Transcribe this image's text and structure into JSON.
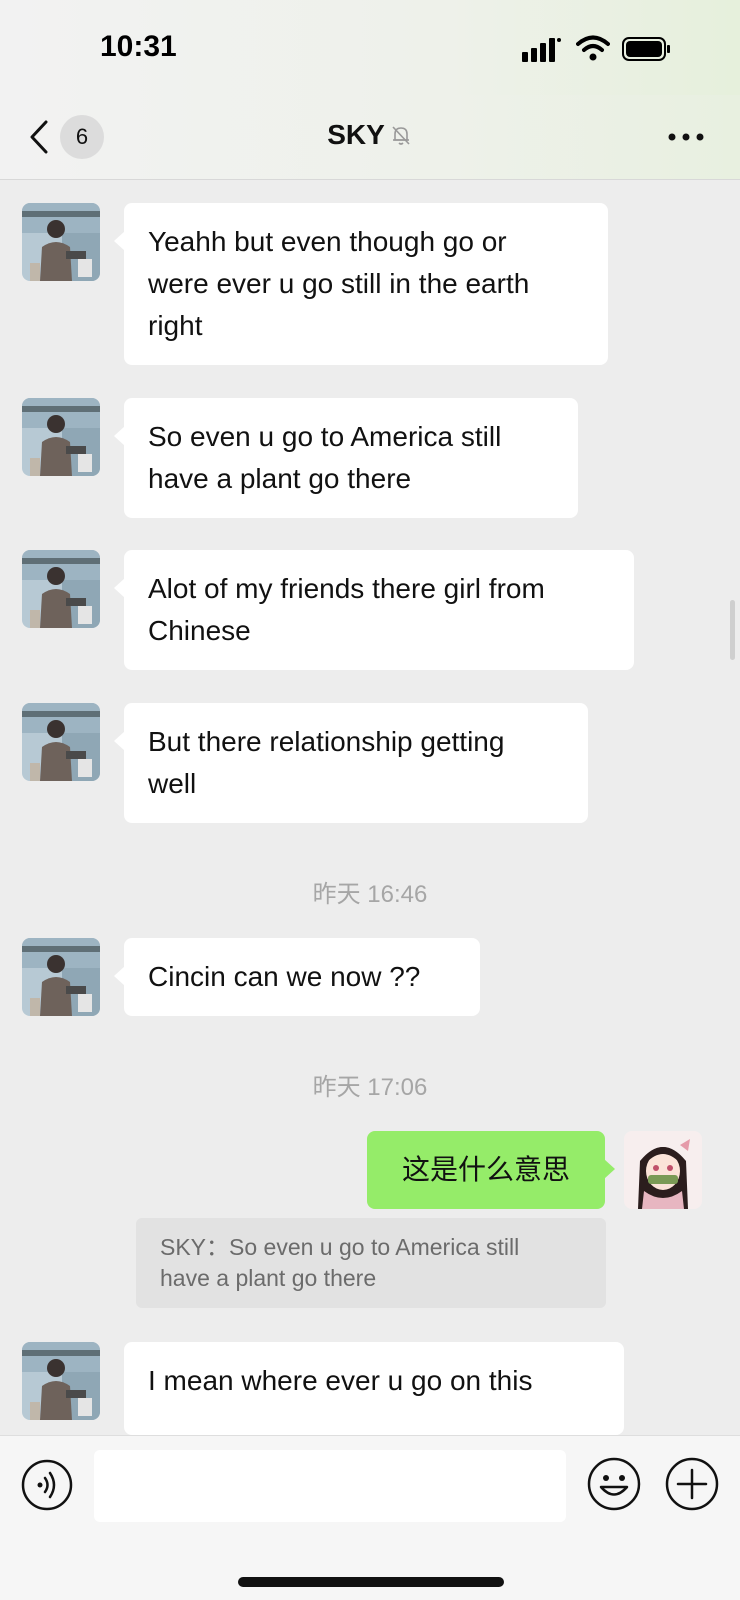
{
  "status_bar": {
    "time": "10:31"
  },
  "header": {
    "unread_count": "6",
    "title": "SKY"
  },
  "messages": [
    {
      "text_lines": [
        "Yeahh but even though go or",
        "were ever u go still in the earth",
        "right"
      ]
    },
    {
      "text_lines": [
        "So even u go to America still",
        "have a plant go there"
      ]
    },
    {
      "text_lines": [
        "Alot of my friends there girl from",
        "Chinese"
      ]
    },
    {
      "text_lines": [
        "But there relationship getting",
        "well"
      ]
    },
    {
      "timestamp": "昨天 16:46"
    },
    {
      "text_lines": [
        "Cincin can we now ??"
      ]
    },
    {
      "timestamp": "昨天 17:06"
    },
    {
      "text_lines": [
        "这是什么意思"
      ],
      "sender": "me"
    },
    {
      "quote_lines": [
        "SKY：So even u go to America still",
        "have a plant go there"
      ]
    },
    {
      "text_lines": [
        "I mean where ever u go on this"
      ]
    }
  ],
  "input_bar": {
    "placeholder": ""
  },
  "colors": {
    "my_bubble": "#95ec69",
    "their_bubble": "#ffffff",
    "chat_background": "#ededed"
  }
}
